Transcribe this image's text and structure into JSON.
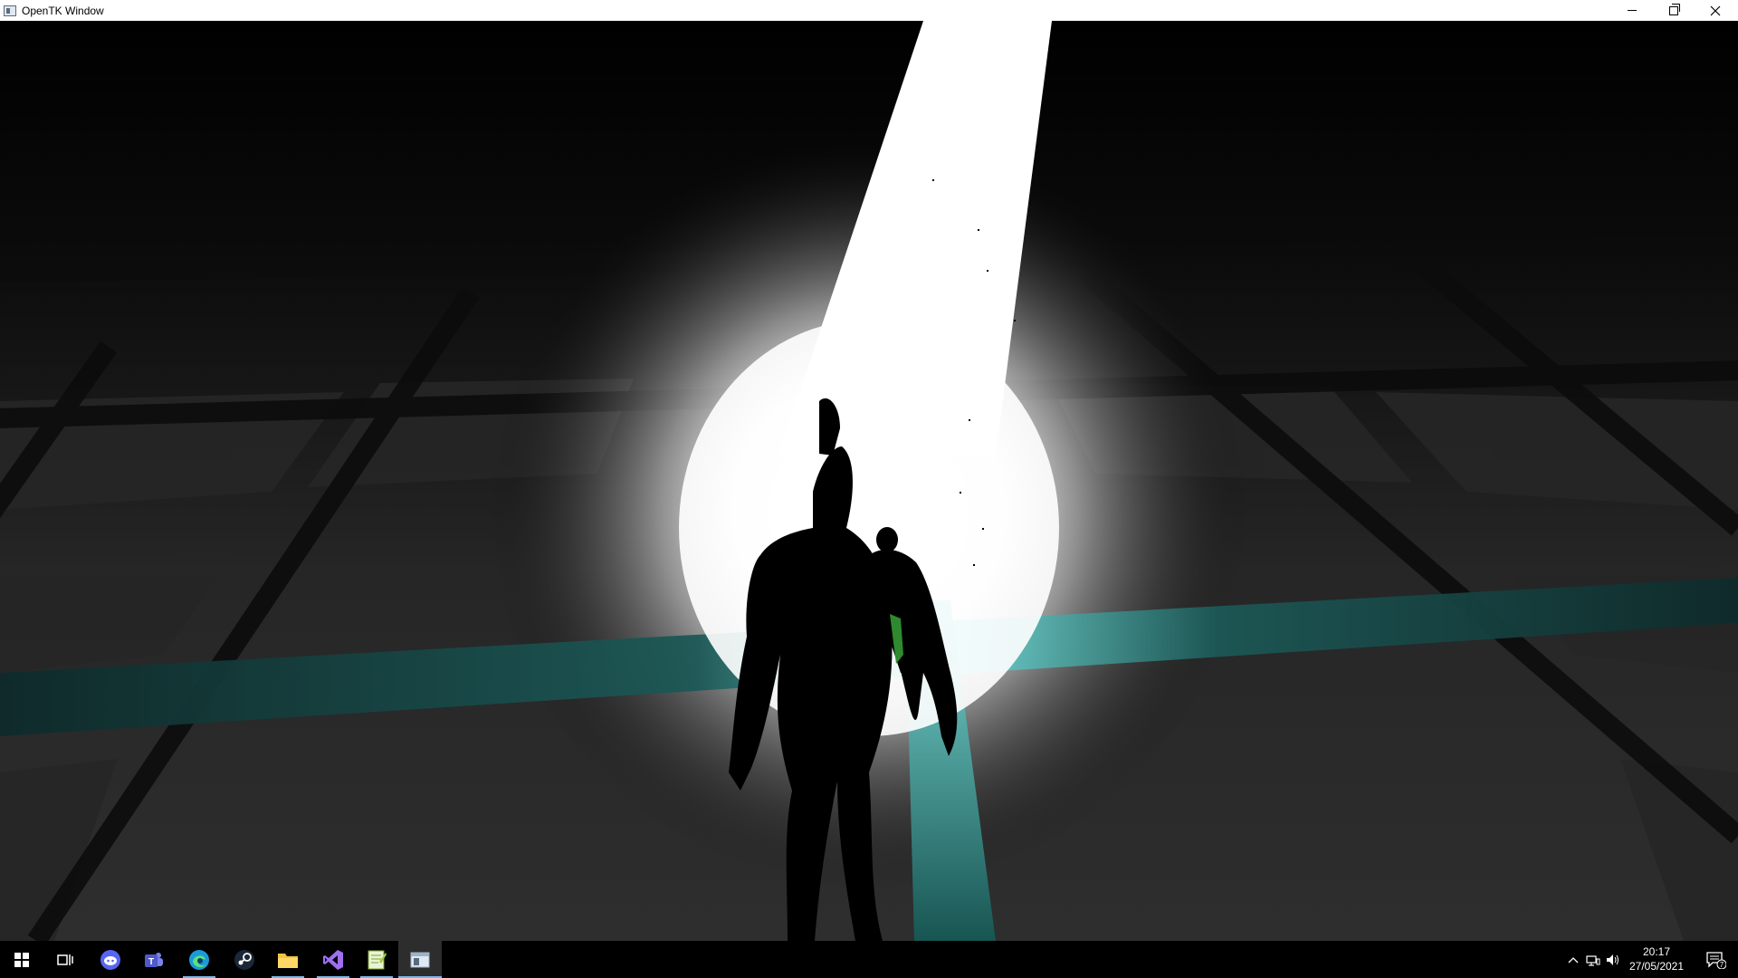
{
  "window": {
    "title": "OpenTK Window",
    "controls": {
      "minimize": "minimize-icon",
      "maximize": "restore-icon",
      "close": "close-icon"
    }
  },
  "scene": {
    "description_colors": {
      "floor": "#3a3a3a",
      "grid_line": "#151515",
      "light": "#ffffff",
      "accent_cyan": "#1b5a58",
      "figure": "#000000",
      "green_highlight": "#2f8a2f"
    }
  },
  "taskbar": {
    "items": [
      {
        "name": "start",
        "icon": "windows-logo-icon"
      },
      {
        "name": "task-view",
        "icon": "task-view-icon"
      },
      {
        "name": "discord",
        "icon": "discord-icon"
      },
      {
        "name": "teams",
        "icon": "teams-icon"
      },
      {
        "name": "edge",
        "icon": "edge-icon"
      },
      {
        "name": "steam",
        "icon": "steam-icon"
      },
      {
        "name": "file-explorer",
        "icon": "folder-icon"
      },
      {
        "name": "visual-studio",
        "icon": "visual-studio-icon"
      },
      {
        "name": "notepad-plus",
        "icon": "notepad-icon"
      },
      {
        "name": "opentk-window",
        "icon": "app-window-icon"
      }
    ],
    "tray": {
      "time": "20:17",
      "date": "27/05/2021",
      "notification_count": "7"
    }
  }
}
